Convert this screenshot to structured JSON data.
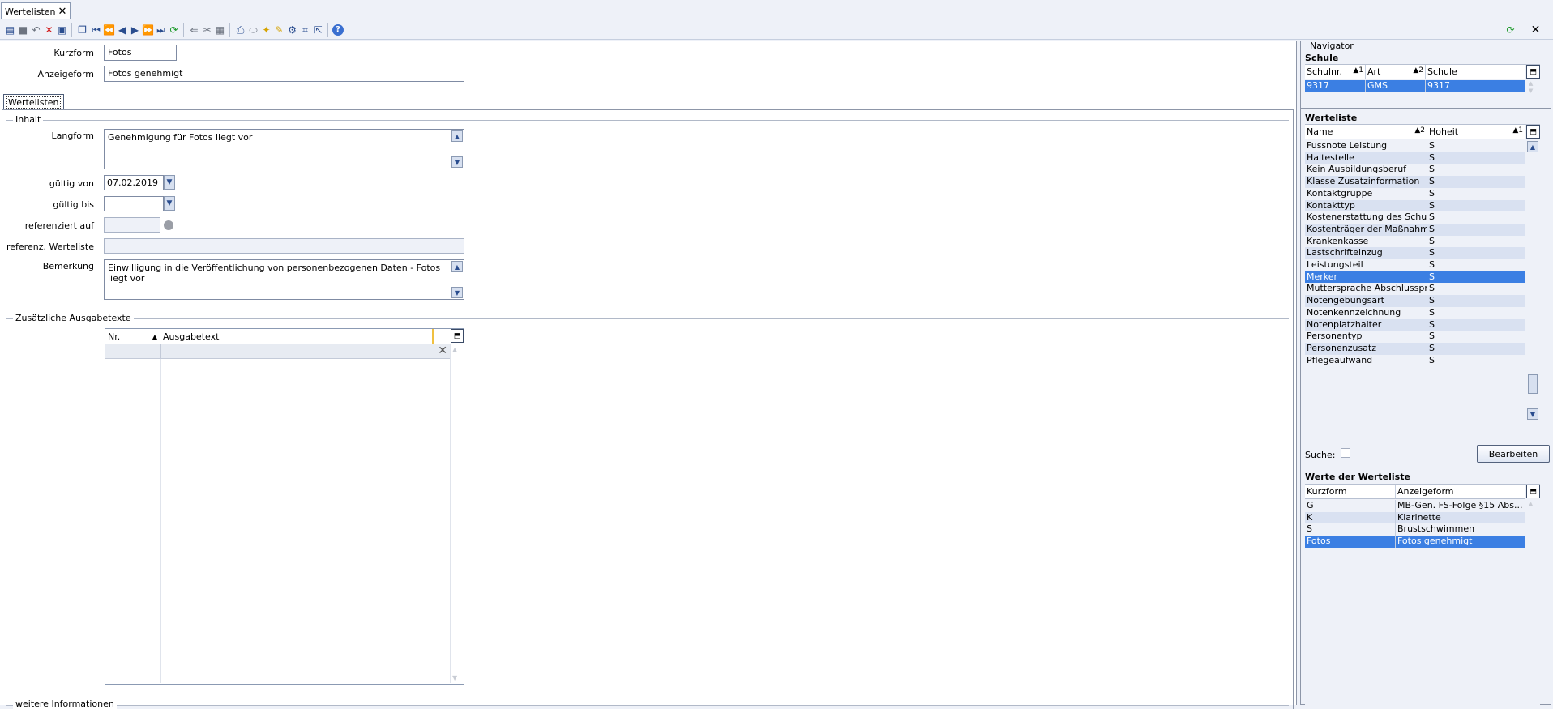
{
  "tab": {
    "label": "Wertelisten",
    "close": "✕"
  },
  "toolbar": {
    "icons": [
      "new-icon",
      "save-icon",
      "undo-icon",
      "delete-icon",
      "save-close-icon",
      "copy-icon",
      "first-icon",
      "prev-page-icon",
      "prev-icon",
      "next-icon",
      "next-page-icon",
      "last-icon",
      "refresh-icon",
      "back-icon",
      "cut-icon",
      "paste-icon",
      "print-icon",
      "preview-icon",
      "hint-icon",
      "clear-icon",
      "settings-icon",
      "select-icon",
      "export-icon",
      "help-icon"
    ],
    "help": "?",
    "window_close": "✕"
  },
  "form": {
    "kurzform_label": "Kurzform",
    "kurzform_value": "Fotos",
    "anzeigeform_label": "Anzeigeform",
    "anzeigeform_value": "Fotos genehmigt",
    "inner_tab": "Wertelisten",
    "group_inhalt": "Inhalt",
    "langform_label": "Langform",
    "langform_value": "Genehmigung für Fotos liegt vor",
    "gueltig_von_label": "gültig von",
    "gueltig_von_value": "07.02.2019",
    "gueltig_bis_label": "gültig bis",
    "gueltig_bis_value": "",
    "referenziert_label": "referenziert auf",
    "referenziert_value": "",
    "referenz_werteliste_label": "referenz. Werteliste",
    "referenz_werteliste_value": "",
    "bemerkung_label": "Bemerkung",
    "bemerkung_value": "Einwilligung in die Veröffentlichung von personenbezogenen Daten - Fotos liegt vor",
    "group_zusaetzliche": "Zusätzliche Ausgabetexte",
    "grid_col_nr": "Nr.",
    "grid_col_text": "Ausgabetext",
    "group_weitere": "weitere Informationen"
  },
  "navigator": {
    "title": "Navigator",
    "schule": {
      "title": "Schule",
      "columns": [
        "Schulnr.",
        "Art",
        "Schule"
      ],
      "sort": [
        "1",
        "2",
        ""
      ],
      "rows": [
        [
          "9317",
          "GMS",
          "9317"
        ]
      ]
    },
    "werteliste": {
      "title": "Werteliste",
      "columns": [
        "Name",
        "Hoheit"
      ],
      "sort": [
        "2",
        "1"
      ],
      "rows": [
        [
          "Fussnote Leistung",
          "S"
        ],
        [
          "Haltestelle",
          "S"
        ],
        [
          "Kein Ausbildungsberuf",
          "S"
        ],
        [
          "Klasse Zusatzinformation",
          "S"
        ],
        [
          "Kontaktgruppe",
          "S"
        ],
        [
          "Kontakttyp",
          "S"
        ],
        [
          "Kostenerstattung des Schulwegs",
          "S"
        ],
        [
          "Kostenträger der Maßnahme",
          "S"
        ],
        [
          "Krankenkasse",
          "S"
        ],
        [
          "Lastschrifteinzug",
          "S"
        ],
        [
          "Leistungsteil",
          "S"
        ],
        [
          "Merker",
          "S"
        ],
        [
          "Muttersprache Abschlussprüfung",
          "S"
        ],
        [
          "Notengebungsart",
          "S"
        ],
        [
          "Notenkennzeichnung",
          "S"
        ],
        [
          "Notenplatzhalter",
          "S"
        ],
        [
          "Personentyp",
          "S"
        ],
        [
          "Personenzusatz",
          "S"
        ],
        [
          "Pflegeaufwand",
          "S"
        ]
      ],
      "selected_index": 11
    },
    "suche_label": "Suche:",
    "bearbeiten_label": "Bearbeiten",
    "werte": {
      "title": "Werte der Werteliste",
      "columns": [
        "Kurzform",
        "Anzeigeform"
      ],
      "rows": [
        [
          "G",
          "MB-Gen. FS-Folge §15 Abs..."
        ],
        [
          "K",
          "Klarinette"
        ],
        [
          "S",
          "Brustschwimmen"
        ],
        [
          "Fotos",
          "Fotos genehmigt"
        ]
      ],
      "selected_index": 3
    }
  }
}
